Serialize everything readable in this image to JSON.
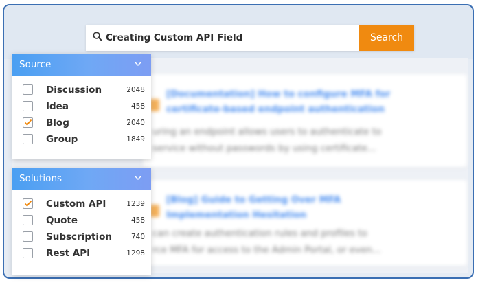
{
  "search": {
    "query": "Creating Custom API Field",
    "button_label": "Search"
  },
  "facets": [
    {
      "title": "Source",
      "items": [
        {
          "label": "Discussion",
          "count": "2048",
          "checked": false
        },
        {
          "label": "Idea",
          "count": "458",
          "checked": false
        },
        {
          "label": "Blog",
          "count": "2040",
          "checked": true
        },
        {
          "label": "Group",
          "count": "1849",
          "checked": false
        }
      ]
    },
    {
      "title": "Solutions",
      "items": [
        {
          "label": "Custom API",
          "count": "1239",
          "checked": true
        },
        {
          "label": "Quote",
          "count": "458",
          "checked": false
        },
        {
          "label": "Subscription",
          "count": "740",
          "checked": false
        },
        {
          "label": "Rest API",
          "count": "1298",
          "checked": false
        }
      ]
    }
  ],
  "results": [
    {
      "title_line1": "[Documentation] How to configure MFA for",
      "title_line2": "certificate-based endpoint authentication",
      "snippet_line1": "uring an endpoint allows users to authenticate to",
      "snippet_line2": "service without passwords by using certificate..."
    },
    {
      "title_line1": "[Blog] Guide to Getting Over MFA",
      "title_line2": "Implementation Hesitation",
      "snippet_line1": "can create authentication rules and profiles to",
      "snippet_line2": "rce MFA for access to the Admin Portal, or even..."
    }
  ],
  "colors": {
    "accent_orange": "#f08a10",
    "facet_header_blue": "#4a9ff2",
    "frame_border": "#3b6fb3",
    "link_blue": "#4a8ef0"
  }
}
